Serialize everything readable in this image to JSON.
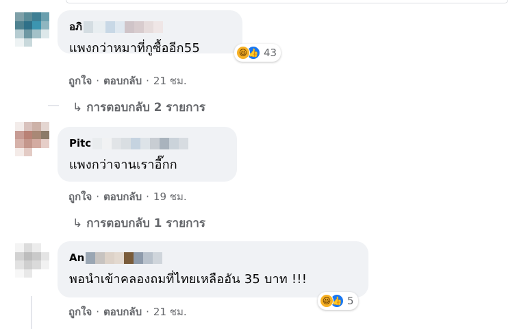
{
  "comments": [
    {
      "author_visible": "อภิ",
      "text": "แพงกว่าหมาที่กูซื้ออีก55",
      "reaction_count": "43",
      "reactions": [
        "haha-icon",
        "like-icon"
      ],
      "like_label": "ถูกใจ",
      "reply_label": "ตอบกลับ",
      "time": "21 ชม.",
      "replies_link": "การตอบกลับ 2 รายการ"
    },
    {
      "author_visible": "Pitc",
      "text": "แพงกว่าจานเราอี๊กก",
      "like_label": "ถูกใจ",
      "reply_label": "ตอบกลับ",
      "time": "19 ชม.",
      "replies_link": "การตอบกลับ 1 รายการ"
    },
    {
      "author_visible": "An",
      "text": "พอนำเข้าคลองถมที่ไทยเหลืออัน 35 บาท !!!",
      "reaction_count": "5",
      "reactions": [
        "haha-icon",
        "like-icon"
      ],
      "like_label": "ถูกใจ",
      "reply_label": "ตอบกลับ",
      "time": "21 ชม."
    }
  ],
  "colors": {
    "bubble": "#f0f2f5",
    "secondary_text": "#65676b",
    "like_blue": "#1877f2",
    "haha_yellow": "#f7b125"
  }
}
